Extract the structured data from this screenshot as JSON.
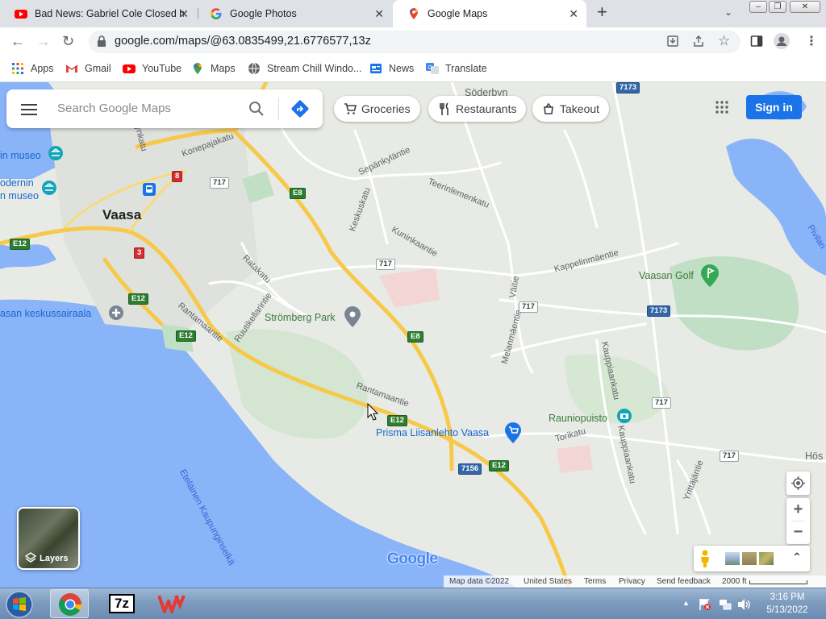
{
  "browser": {
    "tabs": [
      {
        "title": "Bad News: Gabriel Cole Closed his...",
        "icon": "youtube-icon",
        "active": false
      },
      {
        "title": "Google Photos",
        "icon": "google-icon",
        "active": false
      },
      {
        "title": "Google Maps",
        "icon": "maps-icon",
        "active": true
      }
    ],
    "url": "google.com/maps/@63.0835499,21.6776577,13z",
    "bookmarks": [
      {
        "label": "Apps",
        "icon": "apps-grid-icon"
      },
      {
        "label": "Gmail",
        "icon": "gmail-icon"
      },
      {
        "label": "YouTube",
        "icon": "youtube-icon"
      },
      {
        "label": "Maps",
        "icon": "maps-icon"
      },
      {
        "label": "Stream Chill Windo...",
        "icon": "globe-icon"
      },
      {
        "label": "News",
        "icon": "news-icon"
      },
      {
        "label": "Translate",
        "icon": "translate-icon"
      }
    ]
  },
  "maps": {
    "search_placeholder": "Search Google Maps",
    "chips": [
      "Groceries",
      "Restaurants",
      "Takeout"
    ],
    "sign_in": "Sign in",
    "layers_label": "Layers",
    "logo": "Google",
    "attribution": {
      "map_data": "Map data ©2022",
      "country": "United States",
      "terms": "Terms",
      "privacy": "Privacy",
      "feedback": "Send feedback",
      "scale": "2000 ft"
    },
    "places": {
      "city": "Vaasa",
      "soderbyn": "Söderbyn",
      "museo1": "in museo",
      "museo2_l1": "odernin",
      "museo2_l2": "n museo",
      "hospital": "asan keskussairaala",
      "park": "Strömberg Park",
      "golf": "Vaasan Golf",
      "rauniopuisto": "Rauniopuisto",
      "prisma": "Prisma Liisanlehto Vaasa",
      "hos": "Hös",
      "pivilan": "Pivilan",
      "sea": "Eteläinen Kaupunginselkä"
    },
    "streets": {
      "konepajakatu": "Konepajakatu",
      "sepankylantie": "Sepänkyläntie",
      "teerinlemenkatu": "Teerinlemenkatu",
      "keskuskatu": "Keskuskatu",
      "kuninkaantie": "Kuninkaantie",
      "kappelinmaentie": "Kappelinmäentie",
      "ratakatu": "Ratakatu",
      "ruutikellarintie": "Ruutikellarintie",
      "rantamaantie1": "Rantamaantie",
      "rantamaantie2": "Rantamaantie",
      "valtie": "Väitie",
      "melanmaentie": "Melanmäentie",
      "kauppiaankatu1": "Kauppiaankatu",
      "kauppiaankatu2": "Kauppiaankatu",
      "torikatu": "Torikatu",
      "yrittajantie": "Yrittäjäntie",
      "rynkatu": "rynkatu"
    },
    "shields": {
      "r717a": "717",
      "r717b": "717",
      "r717c": "717",
      "r717d": "717",
      "r717e": "717",
      "e8a": "E8",
      "e8b": "E8",
      "e12a": "E12",
      "e12b": "E12",
      "e12c": "E12",
      "e12d": "E12",
      "e12e": "E12",
      "r8": "8",
      "r3": "3",
      "r7173a": "7173",
      "r7173b": "7173",
      "r7156": "7156"
    }
  },
  "taskbar": {
    "time": "3:16 PM",
    "date": "5/13/2022",
    "apps": [
      "start-orb-icon",
      "chrome-icon",
      "7zip-icon",
      "wps-icon"
    ]
  },
  "colors": {
    "water": "#8ab4f8",
    "land": "#e8ebe5",
    "park": "#c0dfc4",
    "highway": "#f6c94a",
    "accent": "#1a73e8"
  }
}
